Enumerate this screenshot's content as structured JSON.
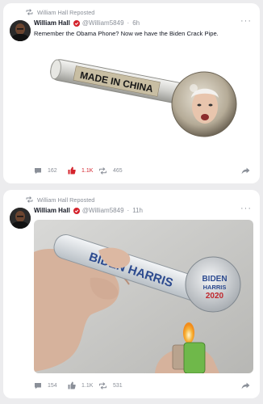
{
  "posts": [
    {
      "repost_label": "William Hall Reposted",
      "author": "William Hall",
      "handle": "@William5849",
      "separator": "·",
      "time": "6h",
      "text": "Remember the Obama Phone? Now we have the Biden Crack Pipe.",
      "image_text": "MADE IN CHINA",
      "comments": "162",
      "likes": "1.1K",
      "reposts": "465",
      "liked": true
    },
    {
      "repost_label": "William Hall Reposted",
      "author": "William Hall",
      "handle": "@William5849",
      "separator": "·",
      "time": "11h",
      "image_text_pipe": "BIDEN HARRIS",
      "image_text_bulb": [
        "BIDEN",
        "HARRIS",
        "2020"
      ],
      "comments": "154",
      "likes": "1.1K",
      "reposts": "531",
      "liked": false
    }
  ],
  "colors": {
    "background": "#ececee",
    "card": "#ffffff",
    "muted": "#8a8f98",
    "like_active": "#d4232c",
    "verified": "#d4232c"
  },
  "icons": [
    "repost-icon",
    "verified-icon",
    "more-icon",
    "comment-icon",
    "like-icon",
    "share-icon"
  ]
}
